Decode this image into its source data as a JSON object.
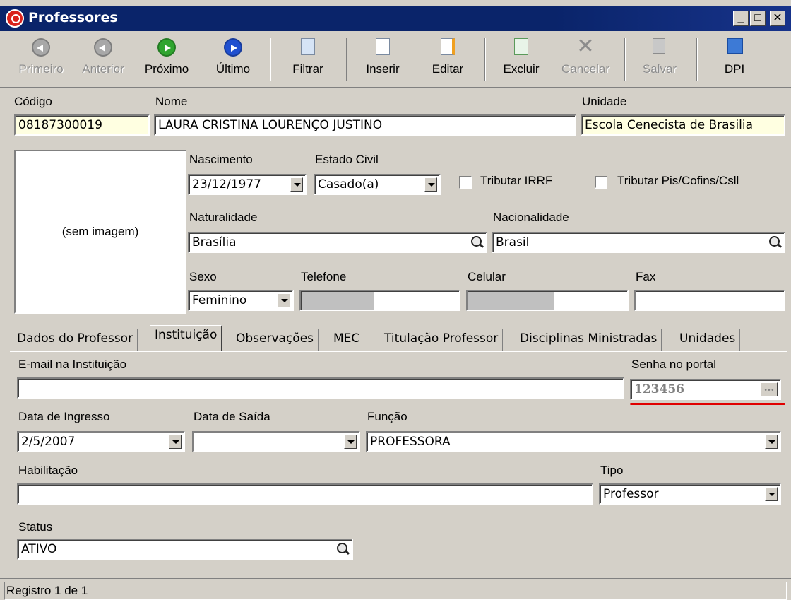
{
  "window": {
    "title": "Professores"
  },
  "toolbar": {
    "first": "Primeiro",
    "prev": "Anterior",
    "next": "Próximo",
    "last": "Último",
    "filter": "Filtrar",
    "insert": "Inserir",
    "edit": "Editar",
    "delete": "Excluir",
    "cancel": "Cancelar",
    "save": "Salvar",
    "dpi": "DPI"
  },
  "form": {
    "codigo_label": "Código",
    "codigo": "08187300019",
    "nome_label": "Nome",
    "nome": "LAURA CRISTINA LOURENÇO JUSTINO",
    "unidade_label": "Unidade",
    "unidade": "Escola Cenecista de Brasilia",
    "photo_placeholder": "(sem imagem)",
    "nascimento_label": "Nascimento",
    "nascimento": "23/12/1977",
    "estado_civil_label": "Estado Civil",
    "estado_civil": "Casado(a)",
    "tributar_irrf": "Tributar IRRF",
    "tributar_pis": "Tributar Pis/Cofins/Csll",
    "naturalidade_label": "Naturalidade",
    "naturalidade": "Brasília",
    "nacionalidade_label": "Nacionalidade",
    "nacionalidade": "Brasil",
    "sexo_label": "Sexo",
    "sexo": "Feminino",
    "telefone_label": "Telefone",
    "celular_label": "Celular",
    "fax_label": "Fax"
  },
  "tabs": [
    {
      "label": "Dados do Professor"
    },
    {
      "label": "Instituição"
    },
    {
      "label": "Observações"
    },
    {
      "label": "MEC"
    },
    {
      "label": "Titulação Professor"
    },
    {
      "label": "Disciplinas Ministradas"
    },
    {
      "label": "Unidades"
    }
  ],
  "instituicao": {
    "email_label": "E-mail na Instituição",
    "email": "",
    "senha_label": "Senha no portal",
    "senha": "123456",
    "senha_button": "...",
    "ingresso_label": "Data de Ingresso",
    "ingresso": "2/5/2007",
    "saida_label": "Data de Saída",
    "saida": "",
    "funcao_label": "Função",
    "funcao": "PROFESSORA",
    "habilitacao_label": "Habilitação",
    "habilitacao": "",
    "tipo_label": "Tipo",
    "tipo": "Professor",
    "status_label": "Status",
    "status": "ATIVO"
  },
  "status_bar": {
    "text": "Registro 1 de 1"
  },
  "colors": {
    "titlebar": "#0a246a",
    "window_bg": "#d4d0c8",
    "highlight_underline": "#e00000",
    "readonly_yellow": "#ffffe1"
  }
}
